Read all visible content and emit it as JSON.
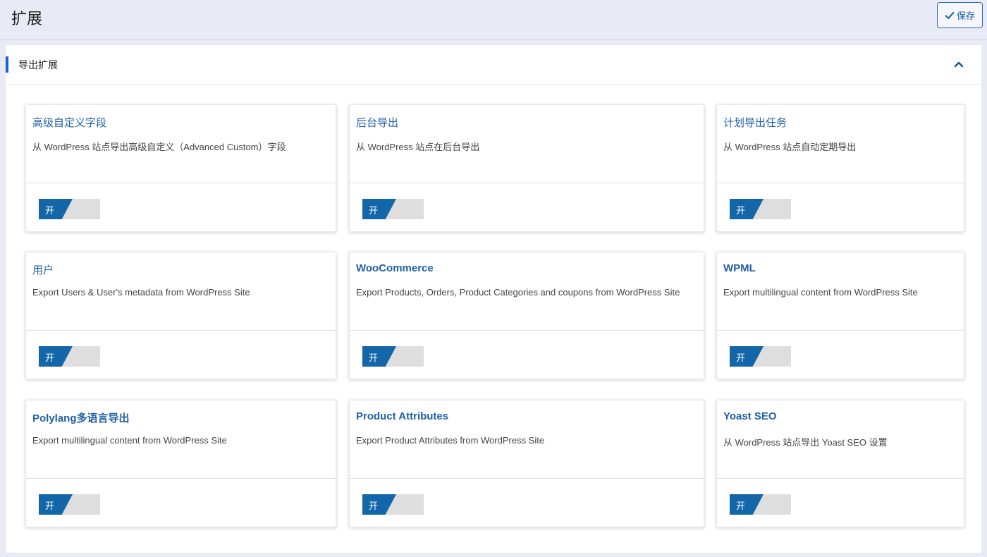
{
  "header": {
    "title": "扩展",
    "save_label": "保存"
  },
  "panel": {
    "title": "导出扩展"
  },
  "cards": [
    {
      "title": "高级自定义字段",
      "description": "从 WordPress 站点导出高级自定义（Advanced Custom）字段",
      "toggle_label": "开"
    },
    {
      "title": "后台导出",
      "description": "从 WordPress 站点在后台导出",
      "toggle_label": "开"
    },
    {
      "title": "计划导出任务",
      "description": "从 WordPress 站点自动定期导出",
      "toggle_label": "开"
    },
    {
      "title": "用户",
      "description": "Export Users & User's metadata from WordPress Site",
      "toggle_label": "开"
    },
    {
      "title": "WooCommerce",
      "description": "Export Products, Orders, Product Categories and coupons from WordPress Site",
      "toggle_label": "开"
    },
    {
      "title": "WPML",
      "description": "Export multilingual content from WordPress Site",
      "toggle_label": "开"
    },
    {
      "title": "Polylang多语言导出",
      "description": "Export multilingual content from WordPress Site",
      "toggle_label": "开"
    },
    {
      "title": "Product Attributes",
      "description": "Export Product Attributes from WordPress Site",
      "toggle_label": "开"
    },
    {
      "title": "Yoast SEO",
      "description": "从 WordPress 站点导出 Yoast SEO 设置",
      "toggle_label": "开"
    }
  ],
  "icons": {
    "save": "check-icon",
    "collapse": "chevron-up-icon"
  },
  "colors": {
    "accent": "#1f5fd6",
    "title_link": "#1f5fa6",
    "toggle_on": "#1366a8",
    "toggle_off": "#dedede"
  }
}
